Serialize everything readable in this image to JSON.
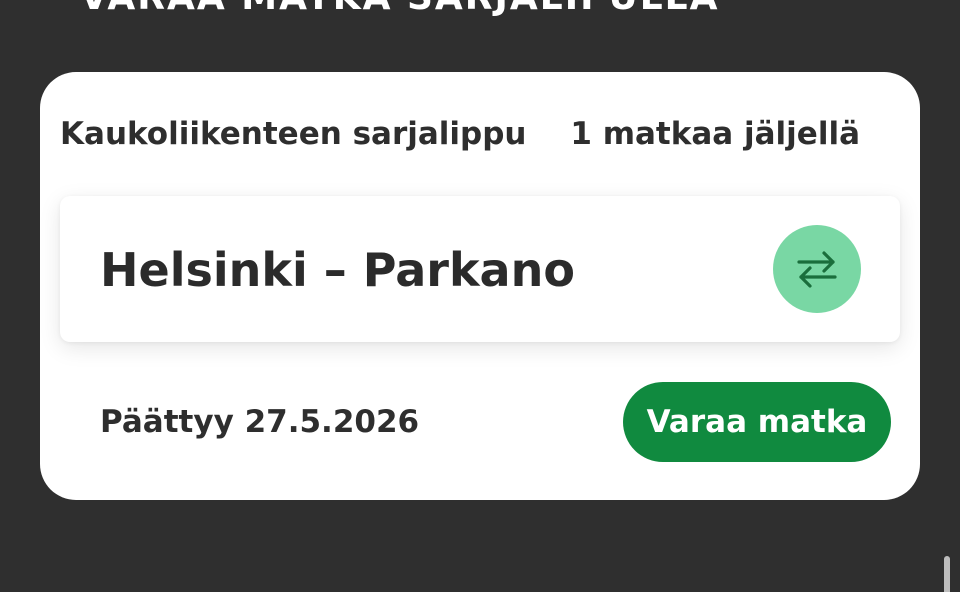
{
  "header": {
    "title": "VARAA MATKA SARJALIPULLA"
  },
  "ticket": {
    "type_label": "Kaukoliikenteen sarjalippu",
    "trips_left": "1 matkaa jäljellä",
    "route": "Helsinki – Parkano",
    "expiry": "Päättyy 27.5.2026",
    "book_label": "Varaa matka",
    "swap_icon": "swap-arrows-icon"
  },
  "colors": {
    "background": "#2f2f2f",
    "card": "#ffffff",
    "accent_green": "#108a3f",
    "swap_circle": "#79d7a4",
    "swap_arrows": "#1a6e3c"
  }
}
